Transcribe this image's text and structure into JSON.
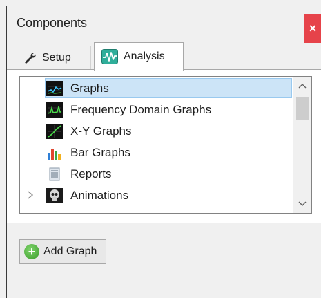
{
  "panel": {
    "title": "Components",
    "close_glyph": "×"
  },
  "tabs": [
    {
      "label": "Setup",
      "icon": "wrench-icon",
      "active": false
    },
    {
      "label": "Analysis",
      "icon": "waveform-icon",
      "active": true
    }
  ],
  "tree": {
    "items": [
      {
        "label": "Graphs",
        "icon": "graph-icon",
        "selected": true,
        "expandable": false
      },
      {
        "label": "Frequency Domain Graphs",
        "icon": "frequency-graph-icon",
        "selected": false,
        "expandable": false
      },
      {
        "label": "X-Y Graphs",
        "icon": "xy-graph-icon",
        "selected": false,
        "expandable": false
      },
      {
        "label": "Bar Graphs",
        "icon": "bar-graph-icon",
        "selected": false,
        "expandable": false
      },
      {
        "label": "Reports",
        "icon": "report-icon",
        "selected": false,
        "expandable": false
      },
      {
        "label": "Animations",
        "icon": "animation-skull-icon",
        "selected": false,
        "expandable": true
      }
    ]
  },
  "actions": {
    "add_graph_label": "Add Graph"
  },
  "colors": {
    "selection_bg": "#cce4f7",
    "selection_border": "#99c9ef",
    "close_bg": "#e6434a"
  }
}
